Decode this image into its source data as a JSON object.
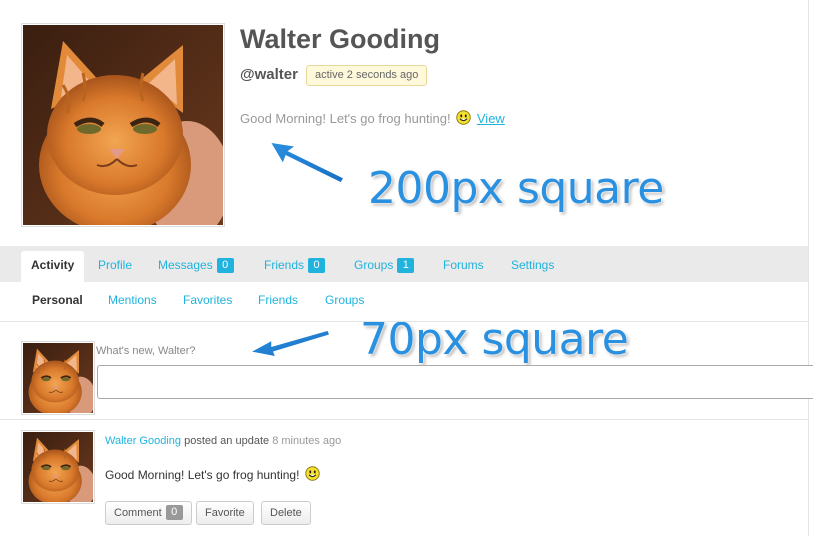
{
  "profile": {
    "name": "Walter Gooding",
    "handle": "@walter",
    "last_active": "active 2 seconds ago",
    "status_text": "Good Morning! Let's go frog hunting!",
    "status_link": "View"
  },
  "annotations": {
    "big_avatar_callout": "200px square",
    "small_avatar_callout": "70px square"
  },
  "tabs": [
    {
      "label": "Activity",
      "count": null
    },
    {
      "label": "Profile",
      "count": null
    },
    {
      "label": "Messages",
      "count": "0"
    },
    {
      "label": "Friends",
      "count": "0"
    },
    {
      "label": "Groups",
      "count": "1"
    },
    {
      "label": "Forums",
      "count": null
    },
    {
      "label": "Settings",
      "count": null
    }
  ],
  "subnav": [
    "Personal",
    "Mentions",
    "Favorites",
    "Friends",
    "Groups"
  ],
  "post_form": {
    "prompt": "What's new, Walter?",
    "value": ""
  },
  "activity": {
    "user": "Walter Gooding",
    "action": "posted an update",
    "time": "8 minutes ago",
    "content": "Good Morning! Let's go frog hunting!",
    "buttons": {
      "comment": "Comment",
      "comment_count": "0",
      "favorite": "Favorite",
      "delete": "Delete"
    }
  },
  "colors": {
    "link": "#1fb3dd",
    "callout": "#2a90e0",
    "badge_bg": "#fff9db"
  },
  "icons": [
    "cat-avatar",
    "smiley-icon",
    "arrow-icon"
  ]
}
